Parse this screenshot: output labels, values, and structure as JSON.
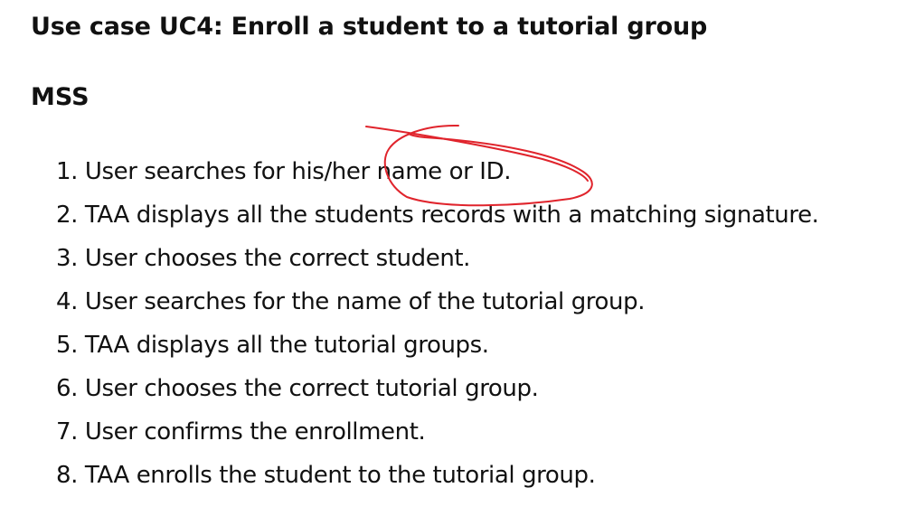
{
  "document": {
    "title": "Use case UC4: Enroll a student to a tutorial group",
    "section_heading": "MSS",
    "steps": [
      {
        "number": "1.",
        "text": "User searches for his/her name or ID."
      },
      {
        "number": "2.",
        "text": "TAA displays all the students records with a matching signature."
      },
      {
        "number": "3.",
        "text": "User chooses the correct student."
      },
      {
        "number": "4.",
        "text": "User searches for the name of the tutorial group."
      },
      {
        "number": "5.",
        "text": "TAA displays all the tutorial groups."
      },
      {
        "number": "6.",
        "text": "User chooses the correct tutorial group."
      },
      {
        "number": "7.",
        "text": "User confirms the enrollment."
      },
      {
        "number": "8.",
        "text": "TAA enrolls the student to the tutorial group."
      }
    ]
  },
  "annotation": {
    "color": "#e0242c"
  }
}
